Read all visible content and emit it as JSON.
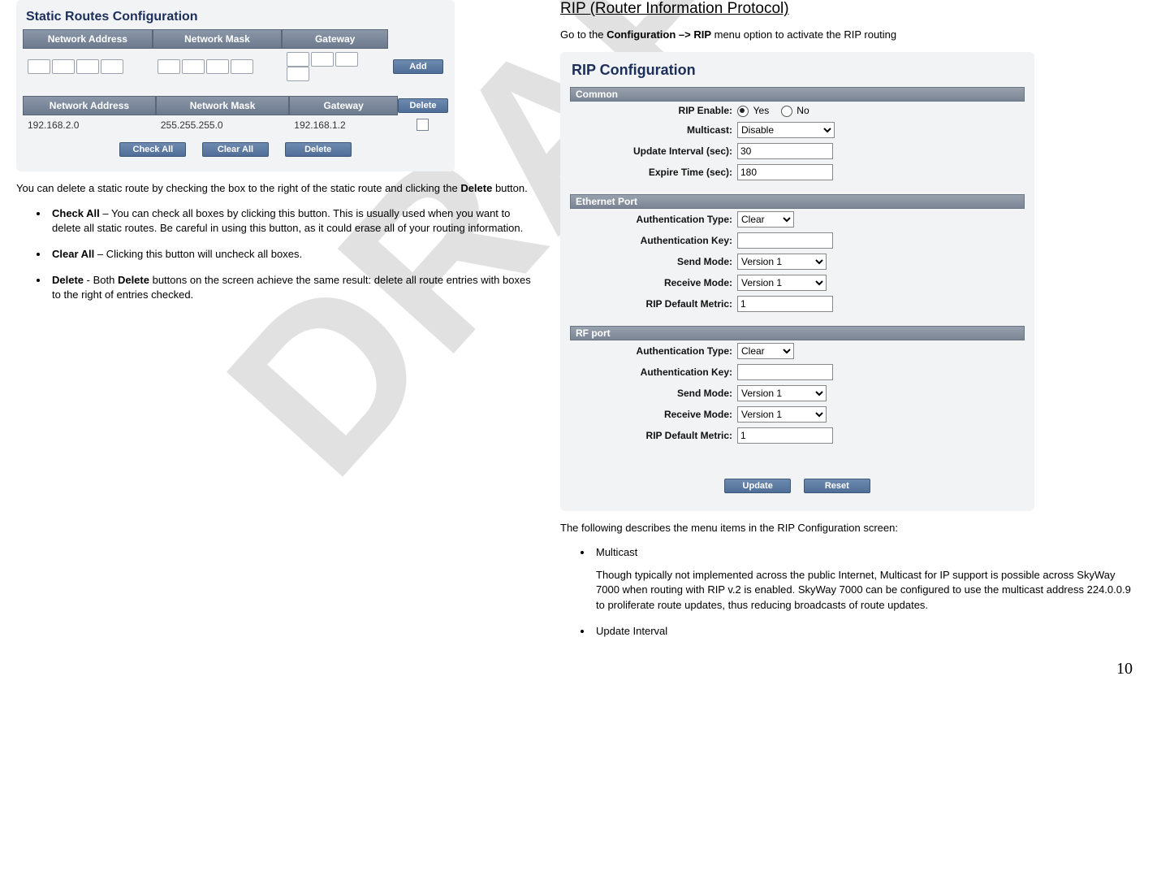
{
  "watermark": "DRAFT",
  "page_number": "10",
  "left": {
    "panel_title": "Static Routes Configuration",
    "columns": {
      "addr": "Network Address",
      "mask": "Network Mask",
      "gw": "Gateway"
    },
    "add_btn": "Add",
    "delete_btn_top": "Delete",
    "row": {
      "addr": "192.168.2.0",
      "mask": "255.255.255.0",
      "gw": "192.168.1.2"
    },
    "buttons": {
      "check_all": "Check All",
      "clear_all": "Clear All",
      "delete": "Delete"
    },
    "para1a": "You can delete a static route by checking the box to the right of the static route and clicking the ",
    "para1b": "Delete",
    "para1c": " button.",
    "bullets": [
      {
        "b": "Check All",
        "t": " – You can check all boxes by clicking this button. This is usually used when you want to delete all static routes. Be careful in using this button, as it could erase all of your routing information."
      },
      {
        "b": "Clear All",
        "t": " – Clicking this button will uncheck all boxes."
      },
      {
        "b": "Delete",
        "t1": " - Both ",
        "b2": "Delete",
        "t2": " buttons on the screen achieve the same result: delete all route entries with boxes to the right of entries checked."
      }
    ]
  },
  "right": {
    "heading": "RIP (Router Information Protocol)",
    "intro_a": "Go to the ",
    "intro_b": "Configuration –> RIP",
    "intro_c": " menu option to activate the RIP routing",
    "panel_title": "RIP Configuration",
    "sections": {
      "common": {
        "hdr": "Common",
        "rip_enable_lbl": "RIP Enable:",
        "yes": "Yes",
        "no": "No",
        "multicast_lbl": "Multicast:",
        "multicast_val": "Disable",
        "update_lbl": "Update Interval (sec):",
        "update_val": "30",
        "expire_lbl": "Expire Time (sec):",
        "expire_val": "180"
      },
      "eth": {
        "hdr": "Ethernet Port",
        "auth_type_lbl": "Authentication Type:",
        "auth_type_val": "Clear",
        "auth_key_lbl": "Authentication Key:",
        "auth_key_val": "",
        "send_lbl": "Send Mode:",
        "send_val": "Version 1",
        "recv_lbl": "Receive Mode:",
        "recv_val": "Version 1",
        "metric_lbl": "RIP Default Metric:",
        "metric_val": "1"
      },
      "rf": {
        "hdr": "RF port",
        "auth_type_lbl": "Authentication Type:",
        "auth_type_val": "Clear",
        "auth_key_lbl": "Authentication Key:",
        "auth_key_val": "",
        "send_lbl": "Send Mode:",
        "send_val": "Version 1",
        "recv_lbl": "Receive Mode:",
        "recv_val": "Version 1",
        "metric_lbl": "RIP Default Metric:",
        "metric_val": "1"
      }
    },
    "buttons": {
      "update": "Update",
      "reset": "Reset"
    },
    "after_para": "The following describes the menu items in the RIP Configuration screen:",
    "bullets": [
      {
        "title": "Multicast",
        "body": "Though typically not implemented across the public Internet, Multicast for IP support is possible across SkyWay 7000 when routing with RIP v.2 is enabled.  SkyWay 7000 can be configured to use the multicast address 224.0.0.9 to proliferate route updates, thus reducing broadcasts of route updates."
      },
      {
        "title": "Update Interval",
        "body": ""
      }
    ]
  }
}
